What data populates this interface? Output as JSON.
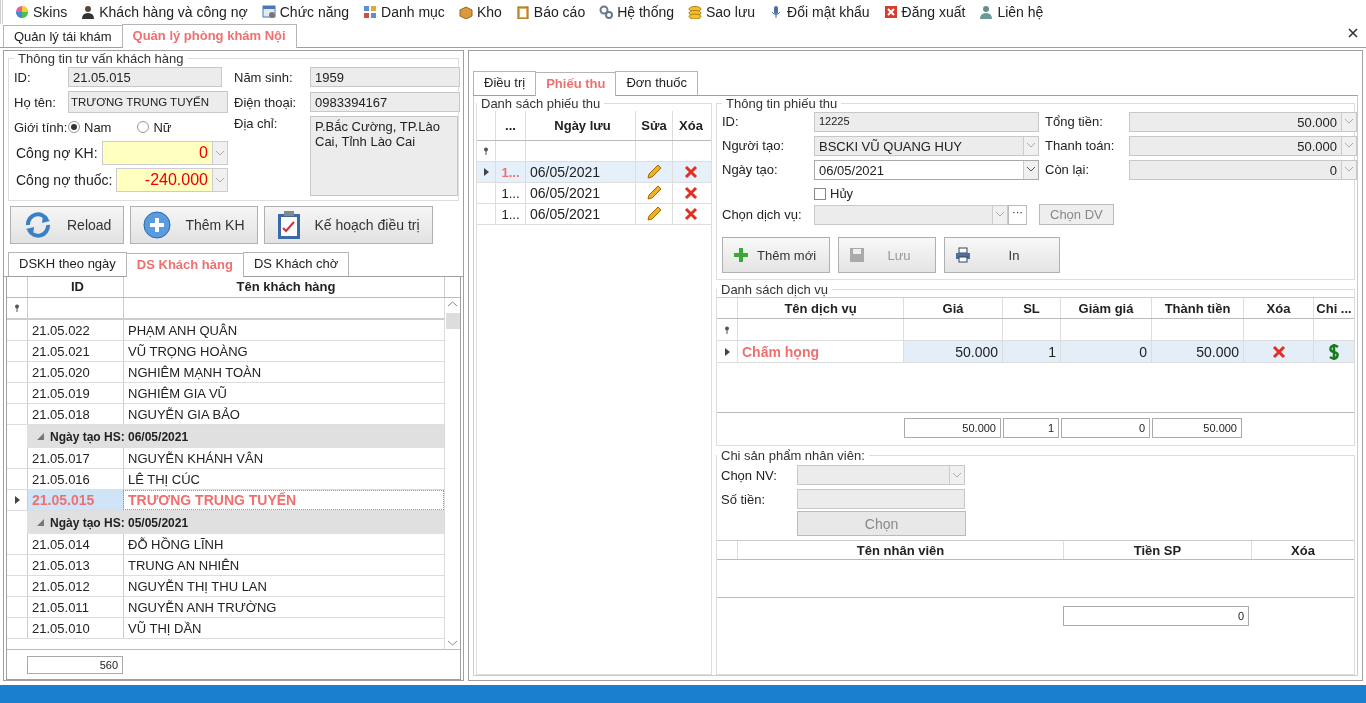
{
  "menu": [
    {
      "label": "Skins"
    },
    {
      "label": "Khách hàng và công nợ"
    },
    {
      "label": "Chức năng"
    },
    {
      "label": "Danh mục"
    },
    {
      "label": "Kho"
    },
    {
      "label": "Báo cáo"
    },
    {
      "label": "Hệ thống"
    },
    {
      "label": "Sao lưu"
    },
    {
      "label": "Đổi mật khẩu"
    },
    {
      "label": "Đăng xuất"
    },
    {
      "label": "Liên hệ"
    }
  ],
  "main_tabs": [
    {
      "label": "Quản lý tái khám",
      "selected": false
    },
    {
      "label": "Quản lý phòng khám Nội",
      "selected": true
    }
  ],
  "customer_info": {
    "title": "Thông tin tư vấn khách hàng",
    "id_label": "ID:",
    "id": "21.05.015",
    "birth_label": "Năm sinh:",
    "birth": "1959",
    "name_label": "Họ tên:",
    "name": "TRƯƠNG TRUNG TUYẾN",
    "phone_label": "Điện thoại:",
    "phone": "0983394167",
    "gender_label": "Giới tính:",
    "genders": [
      {
        "label": "Nam",
        "selected": true
      },
      {
        "label": "Nữ",
        "selected": false
      }
    ],
    "address_label": "Địa chỉ:",
    "address": "P.Bắc Cường, TP.Lào Cai, Tỉnh Lào Cai",
    "debt_label": "Công nợ KH:",
    "debt": "0",
    "drug_debt_label": "Công nợ thuốc:",
    "drug_debt": "-240.000"
  },
  "customer_buttons": [
    {
      "label": "Reload",
      "kind": "reload"
    },
    {
      "label": "Thêm KH",
      "kind": "add"
    },
    {
      "label": "Kế hoạch điều trị",
      "kind": "plan"
    }
  ],
  "list_tabs": [
    {
      "label": "DSKH theo ngày",
      "selected": false
    },
    {
      "label": "DS Khách hàng",
      "selected": true
    },
    {
      "label": "DS Khách chờ",
      "selected": false
    }
  ],
  "customers": {
    "columns": [
      "ID",
      "Tên khách hàng"
    ],
    "rows": [
      {
        "kind": "record",
        "id": "21.05.022",
        "name": "PHẠM ANH QUÂN",
        "selected": false
      },
      {
        "kind": "record",
        "id": "21.05.021",
        "name": "VŨ TRỌNG HOÀNG",
        "selected": false
      },
      {
        "kind": "record",
        "id": "21.05.020",
        "name": "NGHIÊM MẠNH TOÀN",
        "selected": false
      },
      {
        "kind": "record",
        "id": "21.05.019",
        "name": "NGHIÊM GIA VŨ",
        "selected": false
      },
      {
        "kind": "record",
        "id": "21.05.018",
        "name": "NGUYỄN GIA BẢO",
        "selected": false
      },
      {
        "kind": "group",
        "label": "Ngày tạo HS: 06/05/2021"
      },
      {
        "kind": "record",
        "id": "21.05.017",
        "name": "NGUYỄN KHÁNH VÂN",
        "selected": false
      },
      {
        "kind": "record",
        "id": "21.05.016",
        "name": "LÊ THỊ CÚC",
        "selected": false
      },
      {
        "kind": "record",
        "id": "21.05.015",
        "name": "TRƯƠNG TRUNG TUYẾN",
        "selected": true
      },
      {
        "kind": "group",
        "label": "Ngày tạo HS: 05/05/2021"
      },
      {
        "kind": "record",
        "id": "21.05.014",
        "name": "ĐỖ HỒNG LĨNH",
        "selected": false
      },
      {
        "kind": "record",
        "id": "21.05.013",
        "name": "TRUNG AN NHIÊN",
        "selected": false
      },
      {
        "kind": "record",
        "id": "21.05.012",
        "name": "NGUYỄN THỊ THU LAN",
        "selected": false
      },
      {
        "kind": "record",
        "id": "21.05.011",
        "name": "NGUYỄN ANH TRƯỜNG",
        "selected": false
      },
      {
        "kind": "record",
        "id": "21.05.010",
        "name": "VŨ THỊ DẦN",
        "selected": false
      }
    ],
    "count": "560"
  },
  "detail_tabs": [
    {
      "label": "Điều trị",
      "selected": false
    },
    {
      "label": "Phiếu thu",
      "selected": true
    },
    {
      "label": "Đơn thuốc",
      "selected": false
    }
  ],
  "receipts": {
    "title": "Danh sách phiếu thu",
    "columns": [
      "...",
      "Ngày lưu",
      "Sửa",
      "Xóa"
    ],
    "rows": [
      {
        "number": "1...",
        "date": "06/05/2021",
        "selected": true
      },
      {
        "number": "1...",
        "date": "06/05/2021",
        "selected": false
      },
      {
        "number": "1...",
        "date": "06/05/2021",
        "selected": false
      }
    ]
  },
  "receipt_info": {
    "title": "Thông tin phiếu thu",
    "id_label": "ID:",
    "id": "12225",
    "creator_label": "Người tạo:",
    "creator": "BSCKI VŨ QUANG HUY",
    "date_label": "Ngày tạo:",
    "date": "06/05/2021",
    "total_label": "Tổng tiền:",
    "total": "50.000",
    "paid_label": "Thanh toán:",
    "paid": "50.000",
    "remain_label": "Còn lại:",
    "remain": "0",
    "cancel_label": "Hủy",
    "cancelled": false,
    "service_label": "Chọn dịch vụ:",
    "more": "···",
    "choose_service": "Chọn DV",
    "buttons": [
      {
        "label": "Thêm mới",
        "kind": "add",
        "disabled": false
      },
      {
        "label": "Lưu",
        "kind": "save",
        "disabled": true
      },
      {
        "label": "In",
        "kind": "print",
        "disabled": false
      }
    ]
  },
  "services": {
    "title": "Danh sách dịch vụ",
    "columns": [
      "Tên dịch vụ",
      "Giá",
      "SL",
      "Giảm giá",
      "Thành tiền",
      "Xóa",
      "Chi ..."
    ],
    "rows": [
      {
        "name": "Chấm họng",
        "price": "50.000",
        "qty": "1",
        "discount": "0",
        "total": "50.000",
        "selected": true
      }
    ],
    "totals": [
      "50.000",
      "1",
      "0",
      "50.000"
    ]
  },
  "staff": {
    "title": "Chi sản phẩm nhân viên:",
    "staff_label": "Chọn NV:",
    "amount_label": "Số tiền:",
    "choose": "Chọn",
    "columns": [
      "Tên nhân viên",
      "Tiền SP",
      "Xóa"
    ],
    "total": "0"
  }
}
